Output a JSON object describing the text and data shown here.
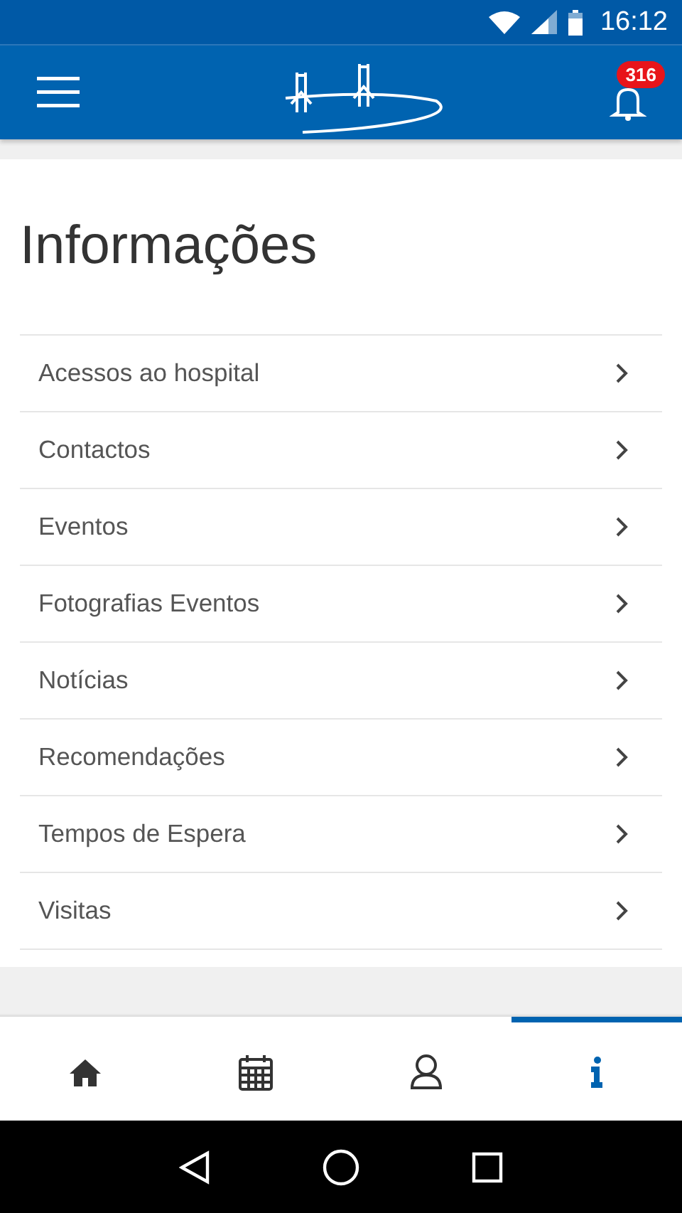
{
  "status_bar": {
    "time": "16:12"
  },
  "app_bar": {
    "notification_count": "316"
  },
  "page": {
    "title": "Informações"
  },
  "items": [
    {
      "label": "Acessos ao hospital"
    },
    {
      "label": "Contactos"
    },
    {
      "label": "Eventos"
    },
    {
      "label": "Fotografias Eventos"
    },
    {
      "label": "Notícias"
    },
    {
      "label": "Recomendações"
    },
    {
      "label": "Tempos de Espera"
    },
    {
      "label": "Visitas"
    }
  ],
  "tabs": [
    {
      "kind": "home",
      "selected": false
    },
    {
      "kind": "calendar",
      "selected": false
    },
    {
      "kind": "profile",
      "selected": false
    },
    {
      "kind": "info",
      "selected": true
    }
  ]
}
